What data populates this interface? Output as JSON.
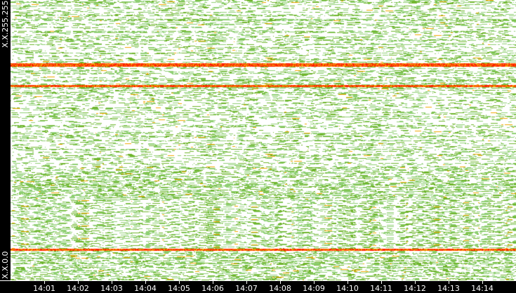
{
  "chart_data": {
    "type": "heatmap",
    "title": "",
    "xlabel": "",
    "ylabel": "",
    "y_tick_labels": [
      "X.X.255.255",
      "X.X.0.0"
    ],
    "x_tick_labels": [
      "14:01",
      "14:02",
      "14:03",
      "14:04",
      "14:05",
      "14:06",
      "14:07",
      "14:08",
      "14:09",
      "14:10",
      "14:11",
      "14:12",
      "14:13",
      "14:14"
    ],
    "xlim_minutes_after_14:00": [
      0,
      15
    ],
    "colors": {
      "low": "#8fcf73",
      "mid": "#6fb52c",
      "high": "#f0a800",
      "max": "#ff2000",
      "background": "#ffffff"
    },
    "hot_rows_fraction_from_top": [
      0.228,
      0.232,
      0.305,
      0.89
    ]
  }
}
